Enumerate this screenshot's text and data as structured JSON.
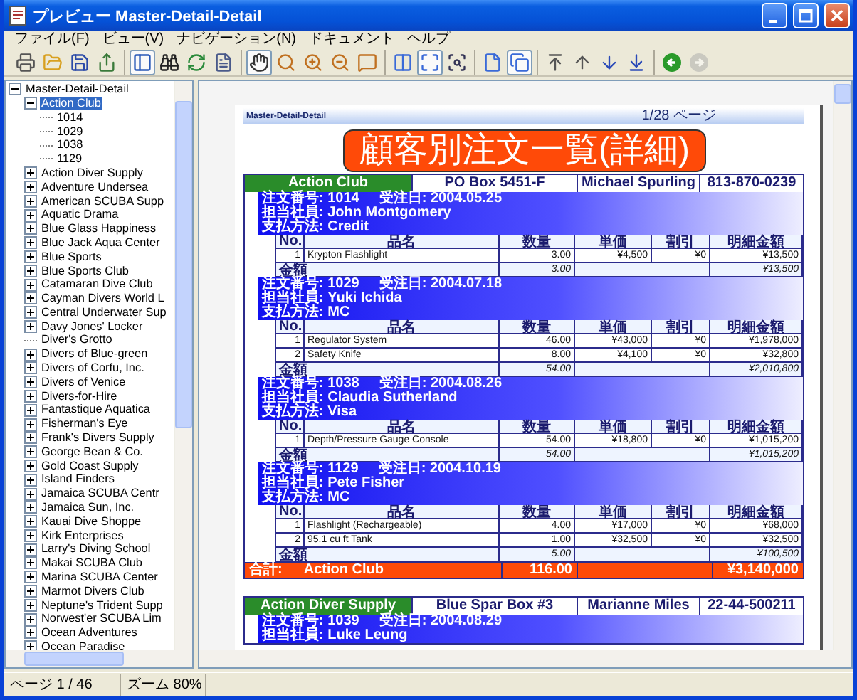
{
  "window": {
    "title": "プレビュー Master-Detail-Detail"
  },
  "menu": [
    {
      "label": "ファイル(F)"
    },
    {
      "label": "ビュー(V)"
    },
    {
      "label": "ナビゲーション(N)"
    },
    {
      "label": "ドキュメント"
    },
    {
      "label": "ヘルプ"
    }
  ],
  "toolbar": [
    {
      "items": [
        {
          "kind": "print",
          "selected": false,
          "disabled": false
        },
        {
          "kind": "open",
          "selected": false,
          "disabled": false
        },
        {
          "kind": "save",
          "selected": false,
          "disabled": false
        },
        {
          "kind": "export",
          "selected": false,
          "disabled": false
        }
      ]
    },
    {
      "items": [
        {
          "kind": "sidebar",
          "selected": true,
          "disabled": false
        },
        {
          "kind": "find",
          "selected": false,
          "disabled": false
        },
        {
          "kind": "refresh",
          "selected": false,
          "disabled": false
        },
        {
          "kind": "document",
          "selected": false,
          "disabled": false
        }
      ]
    },
    {
      "items": [
        {
          "kind": "hand",
          "selected": true,
          "disabled": false
        },
        {
          "kind": "zoom",
          "selected": false,
          "disabled": false
        },
        {
          "kind": "zoom-in",
          "selected": false,
          "disabled": false
        },
        {
          "kind": "zoom-out",
          "selected": false,
          "disabled": false
        },
        {
          "kind": "zoom-text",
          "selected": false,
          "disabled": false
        }
      ]
    },
    {
      "items": [
        {
          "kind": "fit-width",
          "selected": false,
          "disabled": false
        },
        {
          "kind": "fit-page",
          "selected": true,
          "disabled": false
        },
        {
          "kind": "actual-size",
          "selected": false,
          "disabled": false
        }
      ]
    },
    {
      "items": [
        {
          "kind": "single-page",
          "selected": false,
          "disabled": false
        },
        {
          "kind": "multi-page",
          "selected": true,
          "disabled": false
        }
      ]
    },
    {
      "items": [
        {
          "kind": "first",
          "selected": false,
          "disabled": false
        },
        {
          "kind": "previous",
          "selected": false,
          "disabled": false
        },
        {
          "kind": "next",
          "selected": false,
          "disabled": false
        },
        {
          "kind": "last",
          "selected": false,
          "disabled": false
        }
      ]
    },
    {
      "items": [
        {
          "kind": "back",
          "selected": false,
          "disabled": false
        },
        {
          "kind": "forward",
          "selected": false,
          "disabled": true
        }
      ]
    }
  ],
  "tree": {
    "label": "Master-Detail-Detail",
    "kind": "branch",
    "expanded": true,
    "selected": false,
    "children": [
      {
        "label": "Action Club",
        "kind": "branch",
        "expanded": true,
        "selected": true,
        "children": [
          {
            "label": "1014",
            "kind": "leaf",
            "selected": false
          },
          {
            "label": "1029",
            "kind": "leaf",
            "selected": false
          },
          {
            "label": "1038",
            "kind": "leaf",
            "selected": false
          },
          {
            "label": "1129",
            "kind": "leaf",
            "selected": false
          }
        ]
      },
      {
        "label": "Action Diver Supply",
        "kind": "branch",
        "expanded": false,
        "selected": false
      },
      {
        "label": "Adventure Undersea",
        "kind": "branch",
        "expanded": false,
        "selected": false
      },
      {
        "label": "American SCUBA Supp",
        "kind": "branch",
        "expanded": false,
        "selected": false
      },
      {
        "label": "Aquatic Drama",
        "kind": "branch",
        "expanded": false,
        "selected": false
      },
      {
        "label": "Blue Glass Happiness",
        "kind": "branch",
        "expanded": false,
        "selected": false
      },
      {
        "label": "Blue Jack Aqua Center",
        "kind": "branch",
        "expanded": false,
        "selected": false
      },
      {
        "label": "Blue Sports",
        "kind": "branch",
        "expanded": false,
        "selected": false
      },
      {
        "label": "Blue Sports Club",
        "kind": "branch",
        "expanded": false,
        "selected": false
      },
      {
        "label": "Catamaran Dive Club",
        "kind": "branch",
        "expanded": false,
        "selected": false
      },
      {
        "label": "Cayman Divers World L",
        "kind": "branch",
        "expanded": false,
        "selected": false
      },
      {
        "label": "Central Underwater Sup",
        "kind": "branch",
        "expanded": false,
        "selected": false
      },
      {
        "label": "Davy Jones' Locker",
        "kind": "branch",
        "expanded": false,
        "selected": false
      },
      {
        "label": "Diver's Grotto",
        "kind": "leaf",
        "selected": false
      },
      {
        "label": "Divers of Blue-green",
        "kind": "branch",
        "expanded": false,
        "selected": false
      },
      {
        "label": "Divers of Corfu, Inc.",
        "kind": "branch",
        "expanded": false,
        "selected": false
      },
      {
        "label": "Divers of Venice",
        "kind": "branch",
        "expanded": false,
        "selected": false
      },
      {
        "label": "Divers-for-Hire",
        "kind": "branch",
        "expanded": false,
        "selected": false
      },
      {
        "label": "Fantastique Aquatica",
        "kind": "branch",
        "expanded": false,
        "selected": false
      },
      {
        "label": "Fisherman's Eye",
        "kind": "branch",
        "expanded": false,
        "selected": false
      },
      {
        "label": "Frank's Divers Supply",
        "kind": "branch",
        "expanded": false,
        "selected": false
      },
      {
        "label": "George Bean & Co.",
        "kind": "branch",
        "expanded": false,
        "selected": false
      },
      {
        "label": "Gold Coast Supply",
        "kind": "branch",
        "expanded": false,
        "selected": false
      },
      {
        "label": "Island Finders",
        "kind": "branch",
        "expanded": false,
        "selected": false
      },
      {
        "label": "Jamaica SCUBA Centr",
        "kind": "branch",
        "expanded": false,
        "selected": false
      },
      {
        "label": "Jamaica Sun, Inc.",
        "kind": "branch",
        "expanded": false,
        "selected": false
      },
      {
        "label": "Kauai Dive Shoppe",
        "kind": "branch",
        "expanded": false,
        "selected": false
      },
      {
        "label": "Kirk Enterprises",
        "kind": "branch",
        "expanded": false,
        "selected": false
      },
      {
        "label": "Larry's Diving School",
        "kind": "branch",
        "expanded": false,
        "selected": false
      },
      {
        "label": "Makai SCUBA Club",
        "kind": "branch",
        "expanded": false,
        "selected": false
      },
      {
        "label": "Marina SCUBA Center",
        "kind": "branch",
        "expanded": false,
        "selected": false
      },
      {
        "label": "Marmot Divers Club",
        "kind": "branch",
        "expanded": false,
        "selected": false
      },
      {
        "label": "Neptune's Trident Supp",
        "kind": "branch",
        "expanded": false,
        "selected": false
      },
      {
        "label": "Norwest'er SCUBA Lim",
        "kind": "branch",
        "expanded": false,
        "selected": false
      },
      {
        "label": "Ocean Adventures",
        "kind": "branch",
        "expanded": false,
        "selected": false
      },
      {
        "label": "Ocean Paradise",
        "kind": "branch",
        "expanded": false,
        "selected": false
      }
    ]
  },
  "report": {
    "header_left": "Master-Detail-Detail",
    "header_right": "1/28 ページ",
    "title": "顧客別注文一覧(詳細)",
    "customers": [
      {
        "name": "Action Club",
        "address": "PO Box 5451-F",
        "contact": "Michael Spurling",
        "phone": "813-870-0239",
        "orders": [
          {
            "number_line": "注文番号: 1014",
            "date_line": "受注日: 2004.05.25",
            "staff_line": "担当社員: John Montgomery",
            "payment_line": "支払方法: Credit",
            "columns": [
              "No.",
              "品名",
              "数量",
              "単価",
              "割引",
              "明細金額"
            ],
            "items": [
              {
                "no": "1",
                "name": "Krypton Flashlight",
                "quantity": "3.00",
                "price": "¥4,500",
                "discount": "¥0",
                "amount": "¥13,500"
              }
            ],
            "subtotal": {
              "label": "金額",
              "quantity": "3.00",
              "amount": "¥13,500"
            }
          },
          {
            "number_line": "注文番号: 1029",
            "date_line": "受注日: 2004.07.18",
            "staff_line": "担当社員: Yuki Ichida",
            "payment_line": "支払方法: MC",
            "columns": [
              "No.",
              "品名",
              "数量",
              "単価",
              "割引",
              "明細金額"
            ],
            "items": [
              {
                "no": "1",
                "name": "Regulator System",
                "quantity": "46.00",
                "price": "¥43,000",
                "discount": "¥0",
                "amount": "¥1,978,000"
              },
              {
                "no": "2",
                "name": "Safety Knife",
                "quantity": "8.00",
                "price": "¥4,100",
                "discount": "¥0",
                "amount": "¥32,800"
              }
            ],
            "subtotal": {
              "label": "金額",
              "quantity": "54.00",
              "amount": "¥2,010,800"
            }
          },
          {
            "number_line": "注文番号: 1038",
            "date_line": "受注日: 2004.08.26",
            "staff_line": "担当社員: Claudia Sutherland",
            "payment_line": "支払方法: Visa",
            "columns": [
              "No.",
              "品名",
              "数量",
              "単価",
              "割引",
              "明細金額"
            ],
            "items": [
              {
                "no": "1",
                "name": "Depth/Pressure Gauge Console",
                "quantity": "54.00",
                "price": "¥18,800",
                "discount": "¥0",
                "amount": "¥1,015,200"
              }
            ],
            "subtotal": {
              "label": "金額",
              "quantity": "54.00",
              "amount": "¥1,015,200"
            }
          },
          {
            "number_line": "注文番号: 1129",
            "date_line": "受注日: 2004.10.19",
            "staff_line": "担当社員: Pete Fisher",
            "payment_line": "支払方法: MC",
            "columns": [
              "No.",
              "品名",
              "数量",
              "単価",
              "割引",
              "明細金額"
            ],
            "items": [
              {
                "no": "1",
                "name": "Flashlight (Rechargeable)",
                "quantity": "4.00",
                "price": "¥17,000",
                "discount": "¥0",
                "amount": "¥68,000"
              },
              {
                "no": "2",
                "name": "95.1 cu ft Tank",
                "quantity": "1.00",
                "price": "¥32,500",
                "discount": "¥0",
                "amount": "¥32,500"
              }
            ],
            "subtotal": {
              "label": "金額",
              "quantity": "5.00",
              "amount": "¥100,500"
            }
          }
        ],
        "total": {
          "label": "合計:",
          "name": "Action Club",
          "quantity": "116.00",
          "amount": "¥3,140,000"
        }
      },
      {
        "name": "Action Diver Supply",
        "address": "Blue Spar Box #3",
        "contact": "Marianne Miles",
        "phone": "22-44-500211",
        "orders": [
          {
            "number_line": "注文番号: 1039",
            "date_line": "受注日: 2004.08.29",
            "staff_line": "担当社員: Luke Leung"
          }
        ]
      }
    ]
  },
  "status_bar": {
    "page": "ページ 1 / 46",
    "zoom": "ズーム 80%"
  }
}
